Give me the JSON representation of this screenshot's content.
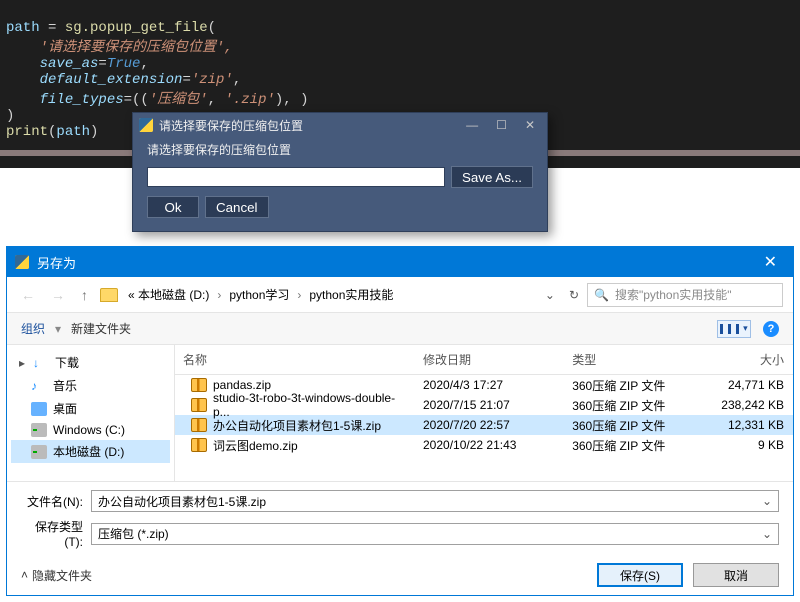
{
  "code": {
    "l1_pre": "path ",
    "l1_eq": "= ",
    "l1_call": "sg.popup_get_file",
    "l1_open": "(",
    "l2": "    '请选择要保存的压缩包位置',",
    "l3_pre": "    ",
    "l3_arg": "save_as",
    "l3_rest": "=True,",
    "l3_true": "True",
    "l4_pre": "    ",
    "l4_arg": "default_extension",
    "l4_rest": "='zip',",
    "l5_pre": "    ",
    "l5_arg": "file_types",
    "l5_rest": "=(('压缩包', '.zip'), )",
    "l6": ")",
    "l7_pre": "print",
    "l7_rest": "(path)"
  },
  "sg": {
    "title": "请选择要保存的压缩包位置",
    "prompt": "请选择要保存的压缩包位置",
    "save_as": "Save As...",
    "ok": "Ok",
    "cancel": "Cancel"
  },
  "save": {
    "title": "另存为",
    "crumb0": "« 本地磁盘 (D:)",
    "crumb1": "python学习",
    "crumb2": "python实用技能",
    "search_placeholder": "搜索\"python实用技能\"",
    "organize": "组织",
    "new_folder": "新建文件夹",
    "col_name": "名称",
    "col_date": "修改日期",
    "col_type": "类型",
    "col_size": "大小",
    "tree": {
      "downloads": "下载",
      "music": "音乐",
      "desktop": "桌面",
      "c": "Windows (C:)",
      "d": "本地磁盘 (D:)"
    },
    "rows": [
      {
        "name": "pandas.zip",
        "date": "2020/4/3 17:27",
        "type": "360压缩 ZIP 文件",
        "size": "24,771 KB",
        "selected": false
      },
      {
        "name": "studio-3t-robo-3t-windows-double-p...",
        "date": "2020/7/15 21:07",
        "type": "360压缩 ZIP 文件",
        "size": "238,242 KB",
        "selected": false
      },
      {
        "name": "办公自动化项目素材包1-5课.zip",
        "date": "2020/7/20 22:57",
        "type": "360压缩 ZIP 文件",
        "size": "12,331 KB",
        "selected": true
      },
      {
        "name": "词云图demo.zip",
        "date": "2020/10/22 21:43",
        "type": "360压缩 ZIP 文件",
        "size": "9 KB",
        "selected": false
      }
    ],
    "filename_label": "文件名(N):",
    "filename_value": "办公自动化项目素材包1-5课.zip",
    "filetype_label": "保存类型(T):",
    "filetype_value": "压缩包 (*.zip)",
    "hide_folders": "隐藏文件夹",
    "btn_save": "保存(S)",
    "btn_cancel": "取消"
  }
}
